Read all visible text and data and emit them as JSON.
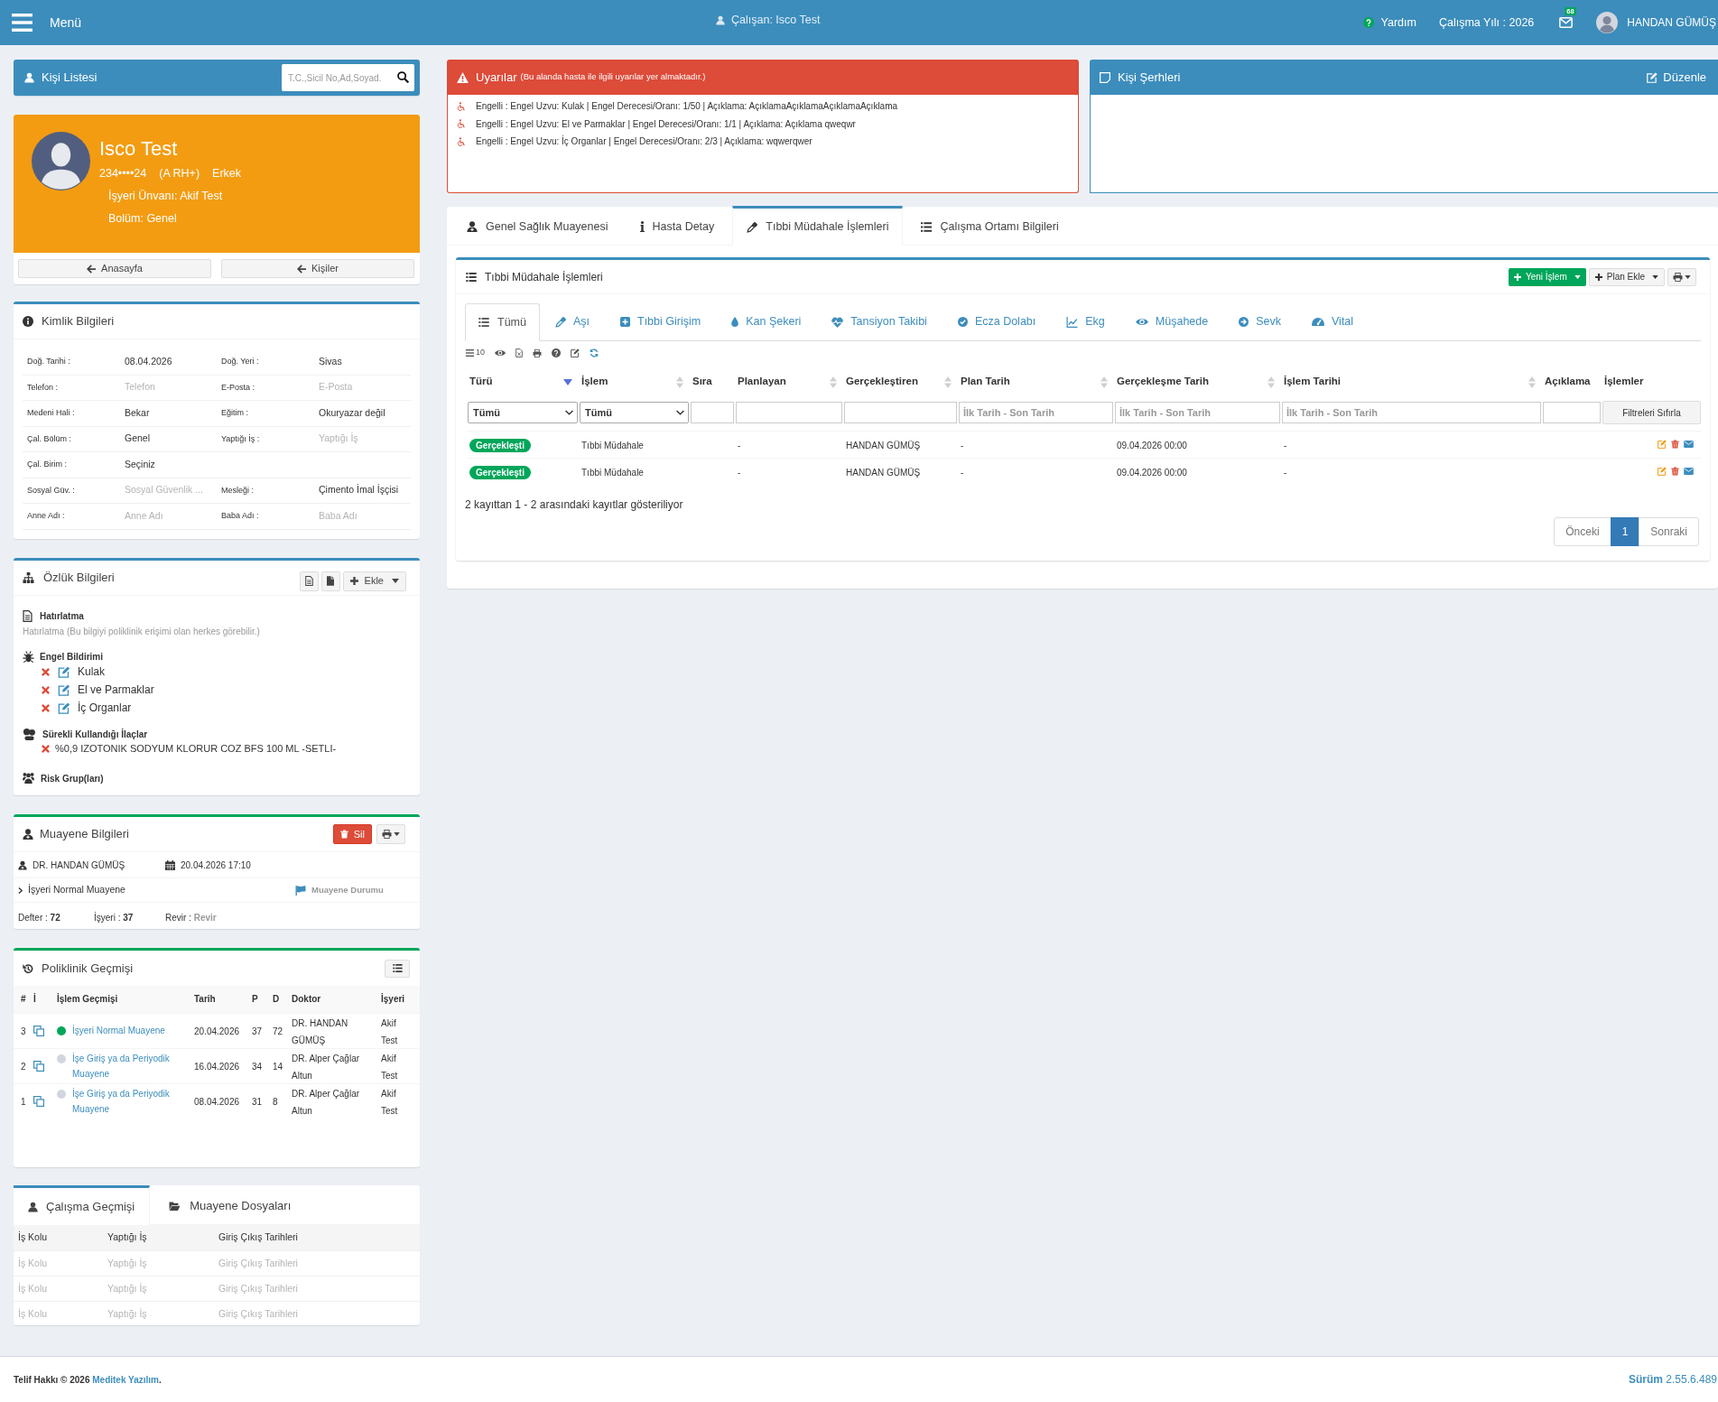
{
  "top_bar": {
    "menu": "Menü",
    "employee": "Çalışan: Isco Test",
    "help": "Yardım",
    "work_year": "Çalışma Yılı : 2026",
    "unread_count": "68",
    "user": "HANDAN GÜMÜŞ"
  },
  "person_list": {
    "title": "Kişi Listesi",
    "search": {
      "placeholder": "T.C.,Sicil No,Ad,Soyad."
    }
  },
  "profile": {
    "name": "Isco Test",
    "id_number": "234••••24",
    "blood_type": "(A RH+)",
    "gender": "Erkek",
    "workplace": "İşyeri Ünvanı: Akif Test",
    "department": "Bolüm: Genel",
    "buttons": [
      "Anasayfa",
      "Kişiler"
    ]
  },
  "identity": {
    "title": "Kimlik Bilgileri",
    "rows": [
      [
        {
          "label": "Doğ. Tarihi :",
          "value": "08.04.2026"
        },
        {
          "label": "Doğ. Yeri :",
          "value": "Sivas"
        }
      ],
      [
        {
          "label": "Telefon :",
          "placeholder": "Telefon"
        },
        {
          "label": "E-Posta :",
          "placeholder": "E-Posta"
        }
      ],
      [
        {
          "label": "Medeni Hali :",
          "value": "Bekar"
        },
        {
          "label": "Eğitim :",
          "value": "Okuryazar değil"
        }
      ],
      [
        {
          "label": "Çal. Bölüm :",
          "value": "Genel"
        },
        {
          "label": "Yaptığı İş :",
          "placeholder": "Yaptığı İş"
        }
      ],
      [
        {
          "label": "Çal. Birim :",
          "value": "Seçiniz"
        }
      ],
      [
        {
          "label": "Sosyal Güv. :",
          "placeholder": "Sosyal Güvenlik ..."
        },
        {
          "label": "Mesleği :",
          "value": "Çimento İmal İşçisi"
        }
      ],
      [
        {
          "label": "Anne Adı :",
          "placeholder": "Anne Adı"
        },
        {
          "label": "Baba Adı :",
          "placeholder": "Baba Adı"
        }
      ]
    ]
  },
  "personal": {
    "title": "Özlük Bilgileri",
    "add_button": "Ekle",
    "reminder": {
      "title": "Hatırlatma",
      "placeholder": "Hatırlatma (Bu bilgiyi poliklinik erişimi olan herkes görebilir.)"
    },
    "disabilities": {
      "title": "Engel Bildirimi",
      "items": [
        "Kulak",
        "El ve Parmaklar",
        "İç Organlar"
      ]
    },
    "medications": {
      "title": "Sürekli Kullandığı İlaçlar",
      "items": [
        "%0,9 IZOTONIK SODYUM KLORUR COZ BFS 100 ML -SETLI-"
      ]
    },
    "risk_groups": {
      "title": "Risk Grup(ları)"
    }
  },
  "examination": {
    "title": "Muayene Bilgileri",
    "delete_button": "Sil",
    "doctor": "DR. HANDAN GÜMÜŞ",
    "date": "20.04.2026 17:10",
    "type": "İşyeri Normal Muayene",
    "status": {
      "placeholder": "Muayene Durumu"
    },
    "counters": [
      {
        "label": "Defter :",
        "value": "72"
      },
      {
        "label": "İşyeri :",
        "value": "37"
      },
      {
        "label": "Revir :",
        "placeholder": "Revir"
      }
    ]
  },
  "clinic_history": {
    "title": "Poliklinik Geçmişi",
    "columns": [
      "#",
      "İ",
      "İşlem Geçmişi",
      "Tarih",
      "P",
      "D",
      "Doktor",
      "İşyeri"
    ],
    "rows": [
      {
        "number": "3",
        "operation": "İşyeri Normal Muayene",
        "color": "#00a65a",
        "date": "20.04.2026",
        "p": "37",
        "d": "72",
        "doctor": "DR. HANDAN GÜMÜŞ",
        "workplace": "Akif Test"
      },
      {
        "number": "2",
        "operation": "İşe Giriş ya da Periyodik Muayene",
        "color": "#d2d6de",
        "date": "16.04.2026",
        "p": "34",
        "d": "14",
        "doctor": "DR. Alper Çağlar Altun",
        "workplace": "Akif Test"
      },
      {
        "number": "1",
        "operation": "İşe Giriş ya da Periyodik Muayene",
        "color": "#d2d6de",
        "date": "08.04.2026",
        "p": "31",
        "d": "8",
        "doctor": "DR. Alper Çağlar Altun",
        "workplace": "Akif Test"
      }
    ]
  },
  "work_history": {
    "tabs": [
      {
        "label": "Çalışma Geçmişi",
        "selected": true
      },
      {
        "label": "Muayene Dosyaları",
        "selected": false
      }
    ],
    "columns": [
      "İş Kolu",
      "Yaptığı İş",
      "Giriş Çıkış Tarihleri"
    ],
    "placeholder_rows": [
      [
        "İş Kolu",
        "Yaptığı İş",
        "Giriş Çıkış Tarihleri"
      ],
      [
        "İş Kolu",
        "Yaptığı İş",
        "Giriş Çıkış Tarihleri"
      ],
      [
        "İş Kolu",
        "Yaptığı İş",
        "Giriş Çıkış Tarihleri"
      ]
    ]
  },
  "warnings": {
    "title": "Uyarılar",
    "subtitle": "(Bu alanda hasta ile ilgili uyarılar yer almaktadır.)",
    "items": [
      "Engelli : Engel Uzvu: Kulak | Engel Derecesi/Oranı: 1/50 | Açıklama: AçıklamaAçıklamaAçıklamaAçıklama",
      "Engelli : Engel Uzvu: El ve Parmaklar | Engel Derecesi/Oranı: 1/1 | Açıklama: Açıklama qweqwr",
      "Engelli : Engel Uzvu: İç Organlar | Engel Derecesi/Oranı: 2/3 | Açıklama: wqwerqwer"
    ]
  },
  "notes": {
    "title": "Kişi Şerhleri",
    "edit_button": "Düzenle"
  },
  "patient_tabs": [
    {
      "label": "Genel Sağlık Muayenesi",
      "selected": false
    },
    {
      "label": "Hasta Detay",
      "selected": false
    },
    {
      "label": "Tıbbi Müdahale İşlemleri",
      "selected": true
    },
    {
      "label": "Çalışma Ortamı Bilgileri",
      "selected": false
    }
  ],
  "procedures": {
    "title": "Tıbbi Müdahale İşlemleri",
    "new_button": "Yeni İşlem",
    "plan_button": "Plan Ekle",
    "tabs": [
      {
        "label": "Tümü",
        "selected": true
      },
      {
        "label": "Aşı",
        "selected": false
      },
      {
        "label": "Tıbbi Girişim",
        "selected": false
      },
      {
        "label": "Kan Şekeri",
        "selected": false
      },
      {
        "label": "Tansiyon Takibi",
        "selected": false
      },
      {
        "label": "Ecza Dolabı",
        "selected": false
      },
      {
        "label": "Ekg",
        "selected": false
      },
      {
        "label": "Müşahede",
        "selected": false
      },
      {
        "label": "Sevk",
        "selected": false
      },
      {
        "label": "Vital",
        "selected": false
      }
    ],
    "page_length": "10",
    "columns": [
      {
        "label": "Türü",
        "sortable": true,
        "sorted": true
      },
      {
        "label": "İşlem",
        "sortable": true,
        "sorted": false
      },
      {
        "label": "Sıra",
        "sortable": false
      },
      {
        "label": "Planlayan",
        "sortable": true,
        "sorted": false
      },
      {
        "label": "Gerçekleştiren",
        "sortable": true,
        "sorted": false
      },
      {
        "label": "Plan Tarih",
        "sortable": true,
        "sorted": false
      },
      {
        "label": "Gerçekleşme Tarih",
        "sortable": true,
        "sorted": false
      },
      {
        "label": "İşlem Tarihi",
        "sortable": true,
        "sorted": false
      },
      {
        "label": "Açıklama",
        "sortable": false
      },
      {
        "label": "İşlemler",
        "sortable": false
      }
    ],
    "filters": [
      {
        "kind": "select",
        "value": "Tümü"
      },
      {
        "kind": "select",
        "value": "Tümü"
      },
      {
        "kind": "input"
      },
      {
        "kind": "input"
      },
      {
        "kind": "input"
      },
      {
        "kind": "input",
        "placeholder": "İlk Tarih - Son Tarih"
      },
      {
        "kind": "input",
        "placeholder": "İlk Tarih - Son Tarih"
      },
      {
        "kind": "input",
        "placeholder": "İlk Tarih - Son Tarih"
      },
      {
        "kind": "input"
      },
      {
        "kind": "button",
        "label": "Filtreleri Sıfırla"
      }
    ],
    "rows": [
      {
        "status": "Gerçekleşti",
        "operation": "Tıbbi Müdahale",
        "planner": "-",
        "performer": "HANDAN GÜMÜŞ",
        "plan_date": "-",
        "done_date": "09.04.2026 00:00",
        "operation_date": "-"
      },
      {
        "status": "Gerçekleşti",
        "operation": "Tıbbi Müdahale",
        "planner": "-",
        "performer": "HANDAN GÜMÜŞ",
        "plan_date": "-",
        "done_date": "09.04.2026 00:00",
        "operation_date": "-"
      }
    ],
    "info": "2 kayıttan 1 - 2 arasındaki kayıtlar gösteriliyor",
    "pagination": [
      {
        "label": "Önceki",
        "selected": false,
        "disabled": true
      },
      {
        "label": "1",
        "selected": true,
        "disabled": false
      },
      {
        "label": "Sonraki",
        "selected": false,
        "disabled": true
      }
    ]
  },
  "footer": {
    "copyright": "Telif Hakkı © 2026",
    "company": "Meditek Yazılım",
    "end": ".",
    "version": "**Sürüm** 2.55.6.489"
  }
}
